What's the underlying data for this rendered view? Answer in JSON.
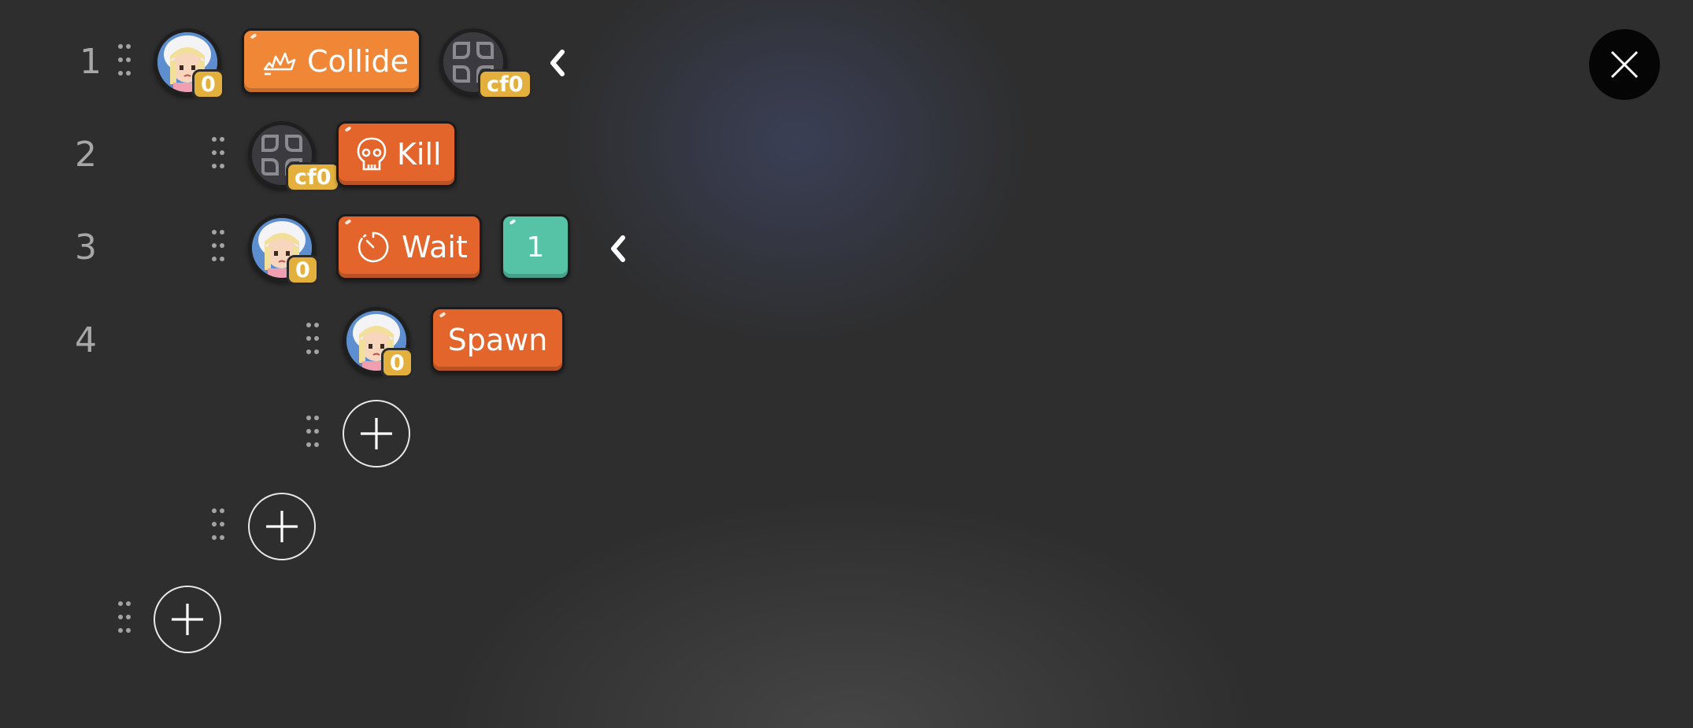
{
  "rows": [
    {
      "number": "1",
      "subject": {
        "type": "character",
        "badge": "0"
      },
      "action": {
        "label": "Collide",
        "icon": "collision-icon"
      },
      "target": {
        "type": "empty-slot",
        "badge": "cf0"
      }
    },
    {
      "number": "2",
      "subject": {
        "type": "empty-slot",
        "badge": "cf0"
      },
      "action": {
        "label": "Kill",
        "icon": "skull-icon"
      }
    },
    {
      "number": "3",
      "subject": {
        "type": "character",
        "badge": "0"
      },
      "action": {
        "label": "Wait",
        "icon": "timer-icon"
      },
      "value": "1"
    },
    {
      "number": "4",
      "subject": {
        "type": "character",
        "badge": "0"
      },
      "action": {
        "label": "Spawn",
        "icon": ""
      }
    }
  ],
  "colors": {
    "collide_block": "#ef8737",
    "action_block": "#e3652b",
    "value_block": "#56c2a6",
    "badge": "#e3b03e",
    "background": "#2e2e2e"
  },
  "icons": {
    "drag_handle": "drag-handle-icon",
    "collapse": "chevron-left-icon",
    "add": "plus-icon",
    "close": "close-icon"
  }
}
